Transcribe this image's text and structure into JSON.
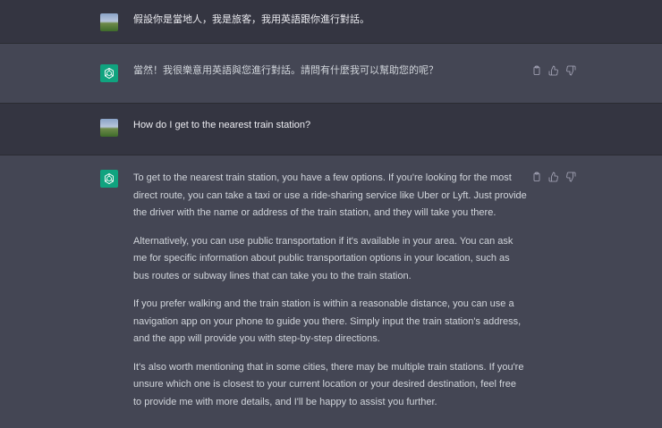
{
  "conversation": {
    "messages": [
      {
        "role": "user",
        "text": "假設你是當地人，我是旅客，我用英語跟你進行對話。"
      },
      {
        "role": "assistant",
        "text": "當然！我很樂意用英語與您進行對話。請問有什麼我可以幫助您的呢？"
      },
      {
        "role": "user",
        "text": "How do I get to the nearest train station?"
      },
      {
        "role": "assistant",
        "paragraphs": [
          "To get to the nearest train station, you have a few options. If you're looking for the most direct route, you can take a taxi or use a ride-sharing service like Uber or Lyft. Just provide the driver with the name or address of the train station, and they will take you there.",
          "Alternatively, you can use public transportation if it's available in your area. You can ask me for specific information about public transportation options in your location, such as bus routes or subway lines that can take you to the train station.",
          "If you prefer walking and the train station is within a reasonable distance, you can use a navigation app on your phone to guide you there. Simply input the train station's address, and the app will provide you with step-by-step directions.",
          "It's also worth mentioning that in some cities, there may be multiple train stations. If you're unsure which one is closest to your current location or your desired destination, feel free to provide me with more details, and I'll be happy to assist you further."
        ]
      }
    ]
  },
  "icons": {
    "copy": "clipboard-icon",
    "thumbs_up": "thumbs-up-icon",
    "thumbs_down": "thumbs-down-icon",
    "assistant_logo": "openai-logo-icon"
  },
  "colors": {
    "user_bg": "#343541",
    "assistant_bg": "#444654",
    "gpt_green": "#10a37f"
  }
}
